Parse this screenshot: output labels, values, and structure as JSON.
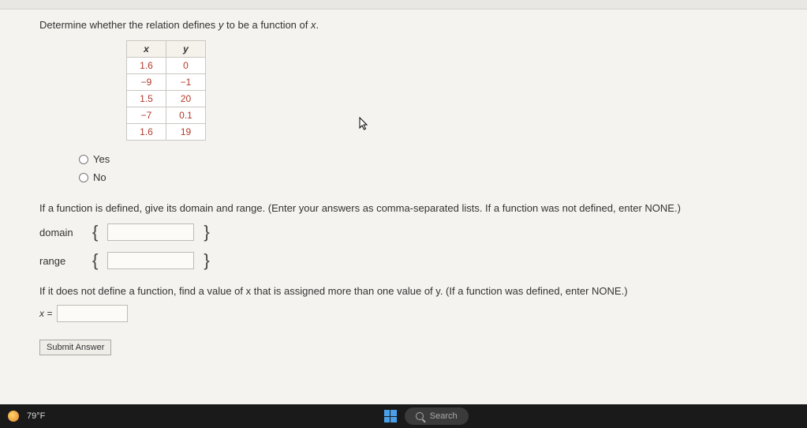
{
  "question": {
    "prompt_pre": "Determine whether the relation defines ",
    "var_y": "y",
    "prompt_mid": " to be a function of ",
    "var_x": "x",
    "prompt_post": "."
  },
  "table": {
    "headers": {
      "x": "x",
      "y": "y"
    },
    "rows": [
      {
        "x": "1.6",
        "y": "0"
      },
      {
        "x": "−9",
        "y": "−1"
      },
      {
        "x": "1.5",
        "y": "20"
      },
      {
        "x": "−7",
        "y": "0.1"
      },
      {
        "x": "1.6",
        "y": "19"
      }
    ]
  },
  "radios": {
    "yes": "Yes",
    "no": "No"
  },
  "domain_range": {
    "intro": "If a function is defined, give its domain and range. (Enter your answers as comma-separated lists. If a function was not defined, enter NONE.)",
    "domain_label": "domain",
    "range_label": "range"
  },
  "not_function": {
    "intro_pre": "If it does not define a function, find a value of ",
    "var_x": "x",
    "intro_mid": " that is assigned more than one value of ",
    "var_y": "y",
    "intro_post": ". (If a function was defined, enter NONE.)",
    "x_equals": "x ="
  },
  "submit": "Submit Answer",
  "taskbar": {
    "temp": "79°F",
    "search": "Search"
  }
}
